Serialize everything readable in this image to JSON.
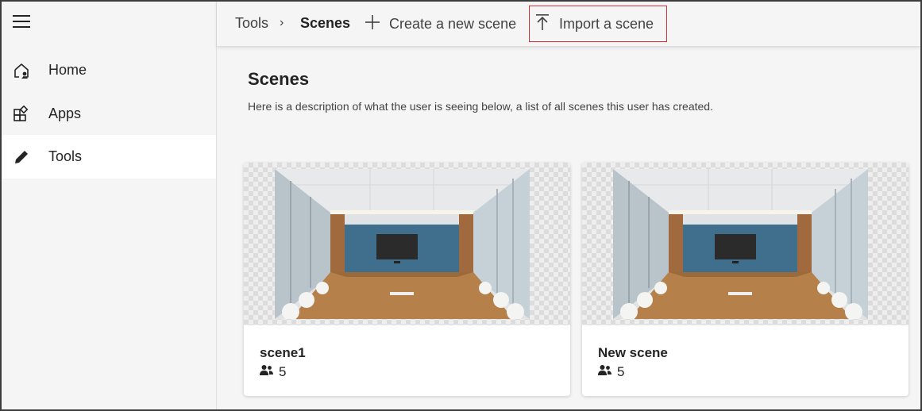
{
  "sidebar": {
    "menu_icon": "hamburger-icon",
    "items": [
      {
        "label": "Home",
        "icon": "home-icon"
      },
      {
        "label": "Apps",
        "icon": "apps-icon"
      },
      {
        "label": "Tools",
        "icon": "pencil-icon",
        "active": true
      }
    ]
  },
  "breadcrumb": {
    "parent": "Tools",
    "separator": "›",
    "current": "Scenes"
  },
  "toolbar": {
    "create_label": "Create a new scene",
    "create_icon": "plus-icon",
    "import_label": "Import a scene",
    "import_icon": "upload-icon"
  },
  "page": {
    "title": "Scenes",
    "description": "Here is a description of what the user is seeing below, a list of all scenes this user has created."
  },
  "scenes": [
    {
      "name": "scene1",
      "people_count": "5",
      "people_icon": "people-icon",
      "thumbnail": "conference-room-image"
    },
    {
      "name": "New scene",
      "people_count": "5",
      "people_icon": "people-icon",
      "thumbnail": "conference-room-image"
    }
  ],
  "colors": {
    "highlight_border": "#d13438",
    "background": "#f5f5f5",
    "active_nav": "#ffffff"
  }
}
